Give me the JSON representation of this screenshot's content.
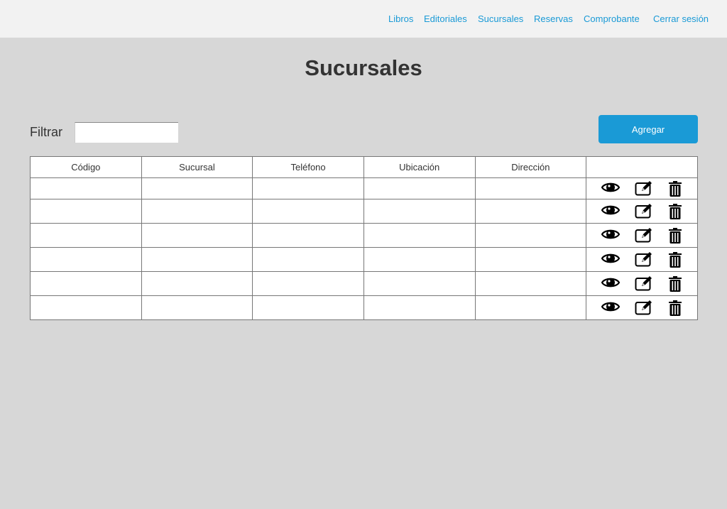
{
  "nav": {
    "items": [
      "Libros",
      "Editoriales",
      "Sucursales",
      "Reservas",
      "Comprobante",
      "Cerrar sesión"
    ]
  },
  "page_title": "Sucursales",
  "filter": {
    "label": "Filtrar",
    "value": "",
    "placeholder": ""
  },
  "add_button": "Agregar",
  "table": {
    "headers": [
      "Código",
      "Sucursal",
      "Teléfono",
      "Ubicación",
      "Dirección",
      ""
    ],
    "rows": [
      [
        "",
        "",
        "",
        "",
        ""
      ],
      [
        "",
        "",
        "",
        "",
        ""
      ],
      [
        "",
        "",
        "",
        "",
        ""
      ],
      [
        "",
        "",
        "",
        "",
        ""
      ],
      [
        "",
        "",
        "",
        "",
        ""
      ],
      [
        "",
        "",
        "",
        "",
        ""
      ]
    ],
    "row_actions": [
      "view-icon",
      "edit-icon",
      "delete-icon"
    ]
  }
}
